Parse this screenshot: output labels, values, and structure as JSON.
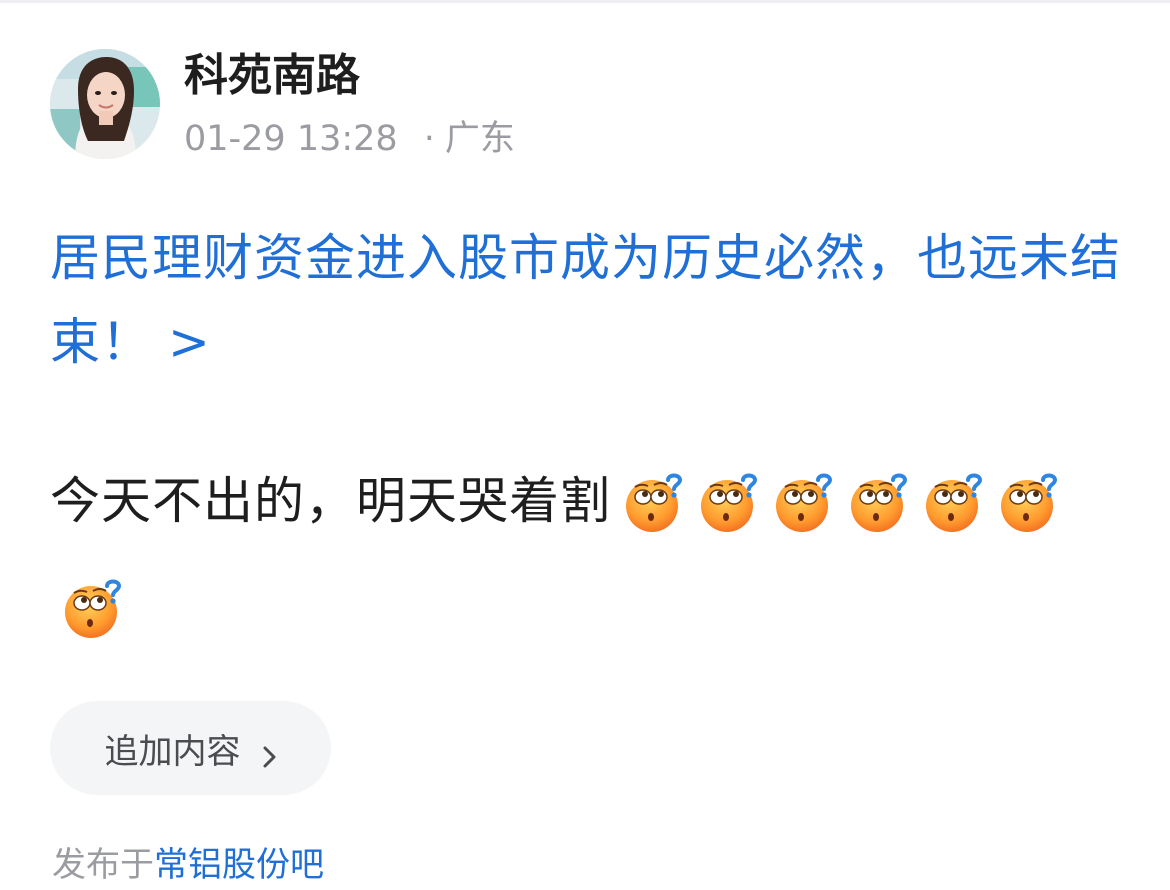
{
  "post": {
    "author": {
      "name": "科苑南路",
      "avatar_icon": "user-avatar-photo"
    },
    "time": "01-29 13:28",
    "separator": "·",
    "location": "广东",
    "topic": {
      "text": "居民理财资金进入股市成为历史必然，也远未结束！",
      "arrow": ">"
    },
    "body": {
      "text": "今天不出的，明天哭着割",
      "emoji_icon": "confused-thinking-emoji",
      "emoji_count": 7
    }
  },
  "actions": {
    "add_content_label": "追加内容",
    "add_content_icon": "chevron-right-icon"
  },
  "footer": {
    "prefix": "发布于",
    "forum_name": "常铝股份吧"
  },
  "colors": {
    "link": "#1f6fd6",
    "text_primary": "#1e1e1e",
    "text_secondary": "#9b9ca1",
    "button_bg": "#f4f5f7"
  }
}
